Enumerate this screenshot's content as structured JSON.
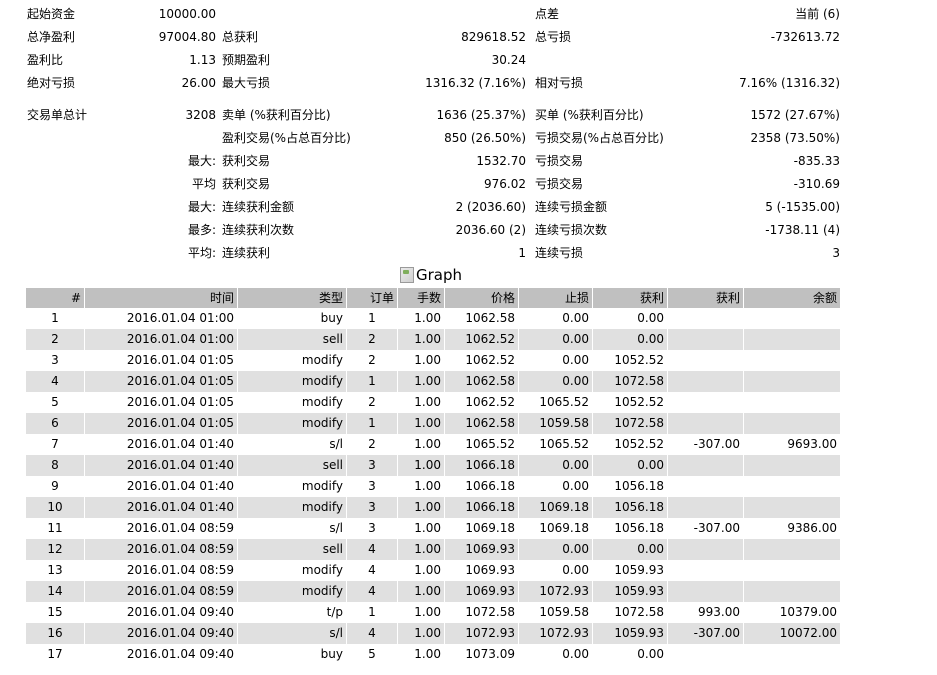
{
  "summary": {
    "initial_deposit_label": "起始资金",
    "initial_deposit": "10000.00",
    "spread_label": "点差",
    "spread": "当前 (6)",
    "total_net_profit_label": "总净盈利",
    "total_net_profit": "97004.80",
    "gross_profit_label": "总获利",
    "gross_profit": "829618.52",
    "gross_loss_label": "总亏损",
    "gross_loss": "-732613.72",
    "profit_factor_label": "盈利比",
    "profit_factor": "1.13",
    "expected_payoff_label": "预期盈利",
    "expected_payoff": "30.24",
    "absolute_dd_label": "绝对亏损",
    "absolute_dd": "26.00",
    "maximal_dd_label": "最大亏损",
    "maximal_dd": "1316.32 (7.16%)",
    "relative_dd_label": "相对亏损",
    "relative_dd": "7.16% (1316.32)",
    "total_trades_label": "交易单总计",
    "total_trades": "3208",
    "short_label": "卖单 (%获利百分比)",
    "short_value": "1636 (25.37%)",
    "long_label": "买单 (%获利百分比)",
    "long_value": "1572 (27.67%)",
    "profit_trades_label": "盈利交易(%占总百分比)",
    "profit_trades_value": "850 (26.50%)",
    "loss_trades_label": "亏损交易(%占总百分比)",
    "loss_trades_value": "2358 (73.50%)",
    "largest_prefix": "最大:",
    "largest_profit_label": "获利交易",
    "largest_profit": "1532.70",
    "largest_loss_label": "亏损交易",
    "largest_loss": "-835.33",
    "average_prefix": "平均",
    "average_profit_label": "获利交易",
    "average_profit": "976.02",
    "average_loss_label": "亏损交易",
    "average_loss": "-310.69",
    "max_cons_prefix": "最大:",
    "max_cons_wins_label": "连续获利金额",
    "max_cons_wins": "2 (2036.60)",
    "max_cons_losses_label": "连续亏损金额",
    "max_cons_losses": "5 (-1535.00)",
    "maximal_prefix": "最多:",
    "maximal_cons_profit_label": "连续获利次数",
    "maximal_cons_profit": "2036.60 (2)",
    "maximal_cons_loss_label": "连续亏损次数",
    "maximal_cons_loss": "-1738.11 (4)",
    "avg_cons_prefix": "平均:",
    "avg_cons_wins_label": "连续获利",
    "avg_cons_wins": "1",
    "avg_cons_losses_label": "连续亏损",
    "avg_cons_losses": "3"
  },
  "graph_alt": "Graph",
  "table": {
    "headers": [
      "#",
      "时间",
      "类型",
      "订单",
      "手数",
      "价格",
      "止损",
      "获利",
      "获利",
      "余额"
    ],
    "rows": [
      [
        "1",
        "2016.01.04 01:00",
        "buy",
        "1",
        "1.00",
        "1062.58",
        "0.00",
        "0.00",
        "",
        ""
      ],
      [
        "2",
        "2016.01.04 01:00",
        "sell",
        "2",
        "1.00",
        "1062.52",
        "0.00",
        "0.00",
        "",
        ""
      ],
      [
        "3",
        "2016.01.04 01:05",
        "modify",
        "2",
        "1.00",
        "1062.52",
        "0.00",
        "1052.52",
        "",
        ""
      ],
      [
        "4",
        "2016.01.04 01:05",
        "modify",
        "1",
        "1.00",
        "1062.58",
        "0.00",
        "1072.58",
        "",
        ""
      ],
      [
        "5",
        "2016.01.04 01:05",
        "modify",
        "2",
        "1.00",
        "1062.52",
        "1065.52",
        "1052.52",
        "",
        ""
      ],
      [
        "6",
        "2016.01.04 01:05",
        "modify",
        "1",
        "1.00",
        "1062.58",
        "1059.58",
        "1072.58",
        "",
        ""
      ],
      [
        "7",
        "2016.01.04 01:40",
        "s/l",
        "2",
        "1.00",
        "1065.52",
        "1065.52",
        "1052.52",
        "-307.00",
        "9693.00"
      ],
      [
        "8",
        "2016.01.04 01:40",
        "sell",
        "3",
        "1.00",
        "1066.18",
        "0.00",
        "0.00",
        "",
        ""
      ],
      [
        "9",
        "2016.01.04 01:40",
        "modify",
        "3",
        "1.00",
        "1066.18",
        "0.00",
        "1056.18",
        "",
        ""
      ],
      [
        "10",
        "2016.01.04 01:40",
        "modify",
        "3",
        "1.00",
        "1066.18",
        "1069.18",
        "1056.18",
        "",
        ""
      ],
      [
        "11",
        "2016.01.04 08:59",
        "s/l",
        "3",
        "1.00",
        "1069.18",
        "1069.18",
        "1056.18",
        "-307.00",
        "9386.00"
      ],
      [
        "12",
        "2016.01.04 08:59",
        "sell",
        "4",
        "1.00",
        "1069.93",
        "0.00",
        "0.00",
        "",
        ""
      ],
      [
        "13",
        "2016.01.04 08:59",
        "modify",
        "4",
        "1.00",
        "1069.93",
        "0.00",
        "1059.93",
        "",
        ""
      ],
      [
        "14",
        "2016.01.04 08:59",
        "modify",
        "4",
        "1.00",
        "1069.93",
        "1072.93",
        "1059.93",
        "",
        ""
      ],
      [
        "15",
        "2016.01.04 09:40",
        "t/p",
        "1",
        "1.00",
        "1072.58",
        "1059.58",
        "1072.58",
        "993.00",
        "10379.00"
      ],
      [
        "16",
        "2016.01.04 09:40",
        "s/l",
        "4",
        "1.00",
        "1072.93",
        "1072.93",
        "1059.93",
        "-307.00",
        "10072.00"
      ],
      [
        "17",
        "2016.01.04 09:40",
        "buy",
        "5",
        "1.00",
        "1073.09",
        "0.00",
        "0.00",
        "",
        ""
      ]
    ]
  }
}
